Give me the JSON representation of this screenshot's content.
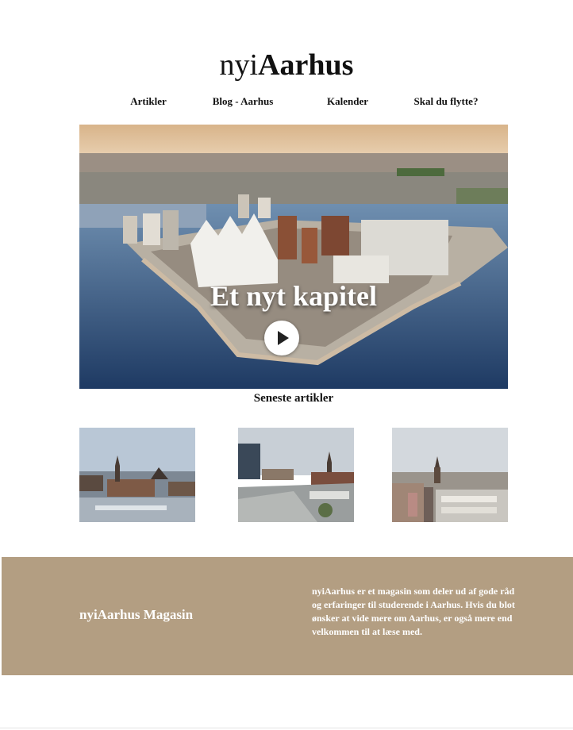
{
  "logo": {
    "prefix": "nyi",
    "name": "Aarhus"
  },
  "nav": {
    "items": [
      {
        "label": "Artikler"
      },
      {
        "label": "Blog - Aarhus"
      },
      {
        "label": "Kalender"
      },
      {
        "label": "Skal du flytte?"
      }
    ]
  },
  "hero": {
    "title": "Et nyt kapitel",
    "play_icon": "play-icon"
  },
  "latest": {
    "title": "Seneste artikler"
  },
  "footer": {
    "title": "nyiAarhus Magasin",
    "text": "nyiAarhus er et magasin som deler ud af gode råd og erfaringer til studerende i Aarhus. Hvis du blot ønsker at vide mere om Aarhus, er også mere end velkommen til at læse med.",
    "background": "#b39e82"
  }
}
